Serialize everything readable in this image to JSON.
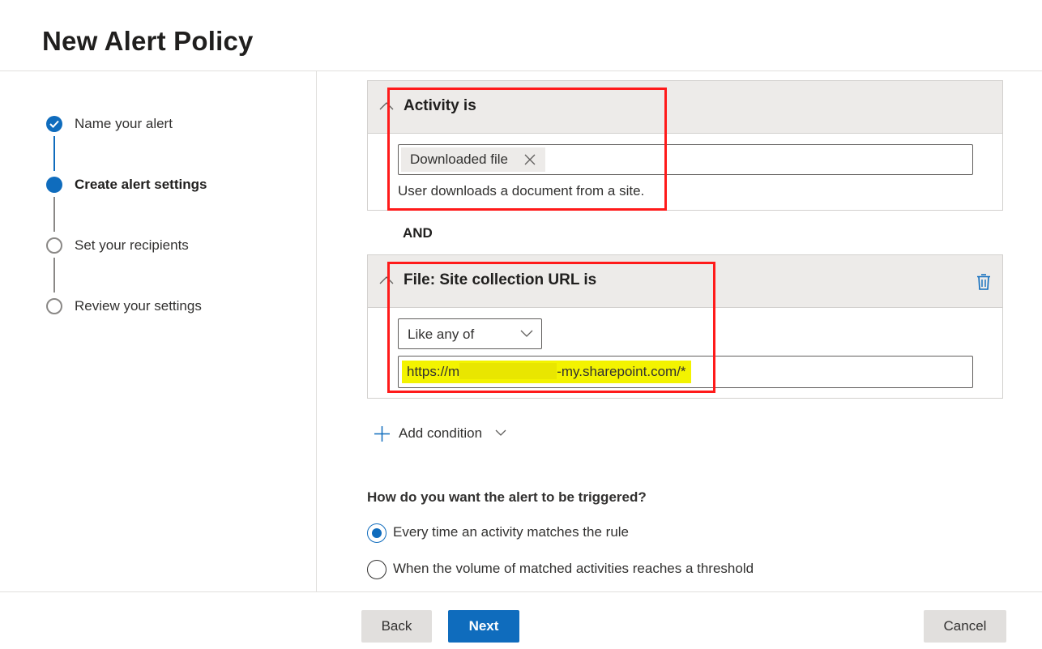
{
  "page": {
    "title": "New Alert Policy"
  },
  "steps": [
    {
      "label": "Name your alert",
      "state": "done"
    },
    {
      "label": "Create alert settings",
      "state": "current"
    },
    {
      "label": "Set your recipients",
      "state": "todo"
    },
    {
      "label": "Review your settings",
      "state": "todo"
    }
  ],
  "conditions": {
    "activity": {
      "title": "Activity is",
      "tag": "Downloaded file",
      "description": "User downloads a document from a site."
    },
    "and_label": "AND",
    "site_url": {
      "title": "File: Site collection URL is",
      "operator": "Like any of",
      "url_prefix": "https://m",
      "url_suffix": "-my.sharepoint.com/*"
    },
    "add_condition_label": "Add condition"
  },
  "trigger": {
    "question": "How do you want the alert to be triggered?",
    "options": [
      {
        "label": "Every time an activity matches the rule",
        "selected": true
      },
      {
        "label": "When the volume of matched activities reaches a threshold",
        "selected": false
      }
    ]
  },
  "footer": {
    "back": "Back",
    "next": "Next",
    "cancel": "Cancel"
  },
  "colors": {
    "accent": "#0f6cbd",
    "annotation": "#ff1a1a",
    "highlight": "#f3f300"
  },
  "icons": [
    "check-icon",
    "chevron-up-icon",
    "dismiss-icon",
    "trash-icon",
    "chevron-down-icon",
    "plus-icon"
  ]
}
